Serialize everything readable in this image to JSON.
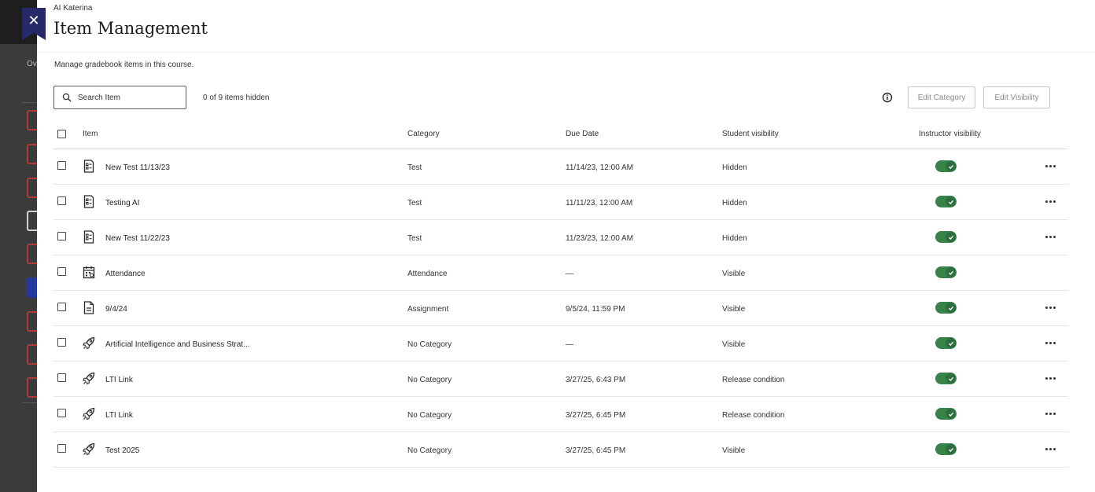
{
  "close_label": "✕",
  "course_name": "AI Katerina",
  "title": "Item Management",
  "description": "Manage gradebook items in this course.",
  "search": {
    "placeholder": "Search Item"
  },
  "hidden_count": "0 of 9 items hidden",
  "buttons": {
    "edit_category": "Edit Category",
    "edit_visibility": "Edit Visibility"
  },
  "columns": {
    "item": "Item",
    "category": "Category",
    "due_date": "Due Date",
    "student_visibility": "Student visibility",
    "instructor_visibility": "Instructor visibility"
  },
  "rows": [
    {
      "icon": "test-icon",
      "name": "New Test 11/13/23",
      "category": "Test",
      "due": "11/14/23, 12:00 AM",
      "student": "Hidden",
      "instructor_on": true,
      "has_menu": true
    },
    {
      "icon": "test-icon",
      "name": "Testing AI",
      "category": "Test",
      "due": "11/11/23, 12:00 AM",
      "student": "Hidden",
      "instructor_on": true,
      "has_menu": true
    },
    {
      "icon": "test-icon",
      "name": "New Test 11/22/23",
      "category": "Test",
      "due": "11/23/23, 12:00 AM",
      "student": "Hidden",
      "instructor_on": true,
      "has_menu": true
    },
    {
      "icon": "attendance-icon",
      "name": "Attendance",
      "category": "Attendance",
      "due": "—",
      "student": "Visible",
      "instructor_on": true,
      "has_menu": false
    },
    {
      "icon": "assignment-icon",
      "name": "9/4/24",
      "category": "Assignment",
      "due": "9/5/24, 11:59 PM",
      "student": "Visible",
      "instructor_on": true,
      "has_menu": true
    },
    {
      "icon": "rocket-icon",
      "name": "Artificial Intelligence and Business Strat...",
      "category": "No Category",
      "due": "—",
      "student": "Visible",
      "instructor_on": true,
      "has_menu": true
    },
    {
      "icon": "rocket-icon",
      "name": "LTI Link",
      "category": "No Category",
      "due": "3/27/25, 6:43 PM",
      "student": "Release condition",
      "instructor_on": true,
      "has_menu": true
    },
    {
      "icon": "rocket-icon",
      "name": "LTI Link",
      "category": "No Category",
      "due": "3/27/25, 6:45 PM",
      "student": "Release condition",
      "instructor_on": true,
      "has_menu": true
    },
    {
      "icon": "rocket-icon",
      "name": "Test 2025",
      "category": "No Category",
      "due": "3/27/25, 6:45 PM",
      "student": "Visible",
      "instructor_on": true,
      "has_menu": true
    }
  ],
  "background_panel": {
    "label": "Ov"
  },
  "colors": {
    "toggle_on": "#37834a",
    "close_bg": "#262a6a"
  }
}
